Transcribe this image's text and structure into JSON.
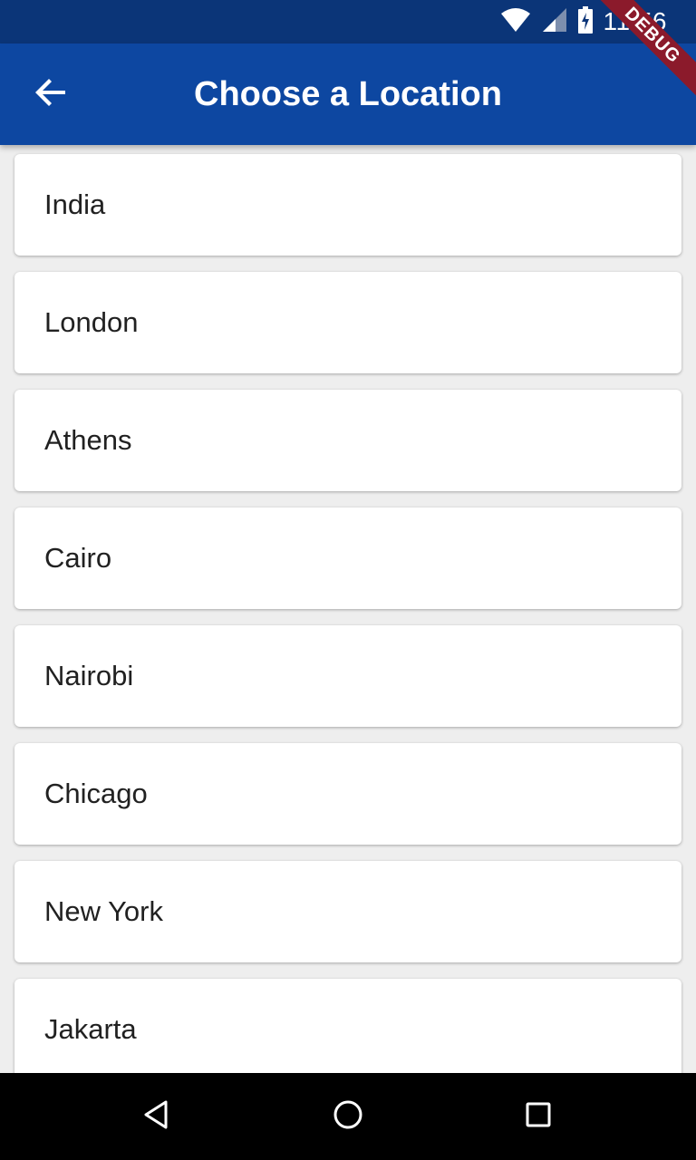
{
  "status_bar": {
    "time": "11:56",
    "icons": [
      "wifi-icon",
      "cell-signal-icon",
      "battery-charging-icon"
    ],
    "background": "#0b3578"
  },
  "app_bar": {
    "title": "Choose a Location",
    "back_icon": "arrow-back-icon",
    "background": "#0d47a1"
  },
  "debug_banner": "DEBUG",
  "locations": [
    {
      "label": "India"
    },
    {
      "label": "London"
    },
    {
      "label": "Athens"
    },
    {
      "label": "Cairo"
    },
    {
      "label": "Nairobi"
    },
    {
      "label": "Chicago"
    },
    {
      "label": "New York"
    },
    {
      "label": "Jakarta"
    }
  ],
  "nav_bar": {
    "buttons": [
      "nav-back-icon",
      "nav-home-icon",
      "nav-recents-icon"
    ]
  }
}
